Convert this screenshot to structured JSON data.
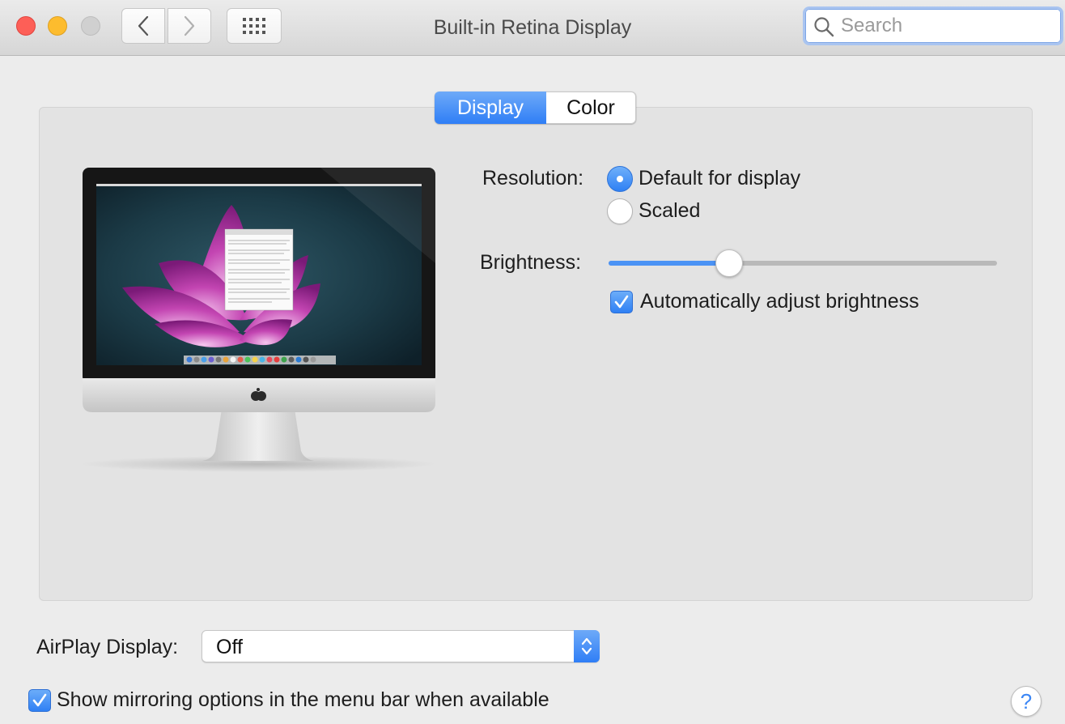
{
  "window": {
    "title": "Built-in Retina Display",
    "search_placeholder": "Search"
  },
  "tabs": [
    {
      "label": "Display",
      "active": true
    },
    {
      "label": "Color",
      "active": false
    }
  ],
  "resolution": {
    "label": "Resolution:",
    "options": [
      {
        "label": "Default for display",
        "selected": true
      },
      {
        "label": "Scaled",
        "selected": false
      }
    ]
  },
  "brightness": {
    "label": "Brightness:",
    "value_fraction": 0.31,
    "auto_adjust_label": "Automatically adjust brightness",
    "auto_adjust_checked": true
  },
  "airplay": {
    "label": "AirPlay Display:",
    "selected": "Off"
  },
  "mirroring": {
    "label": "Show mirroring options in the menu bar when available",
    "checked": true
  },
  "help_label": "?",
  "icons": {
    "close": "close-button",
    "minimize": "minimize-button",
    "zoom": "zoom-button",
    "back": "chevron-left-icon",
    "forward": "chevron-right-icon",
    "show_all": "grid-icon",
    "search": "search-icon",
    "popup": "updown-arrows-icon",
    "check": "checkmark-icon"
  },
  "colors": {
    "accent": "#2f7ef6",
    "close": "#fd5f57",
    "minimize": "#fdbc2e",
    "zoom_disabled": "#d0d0d0"
  }
}
